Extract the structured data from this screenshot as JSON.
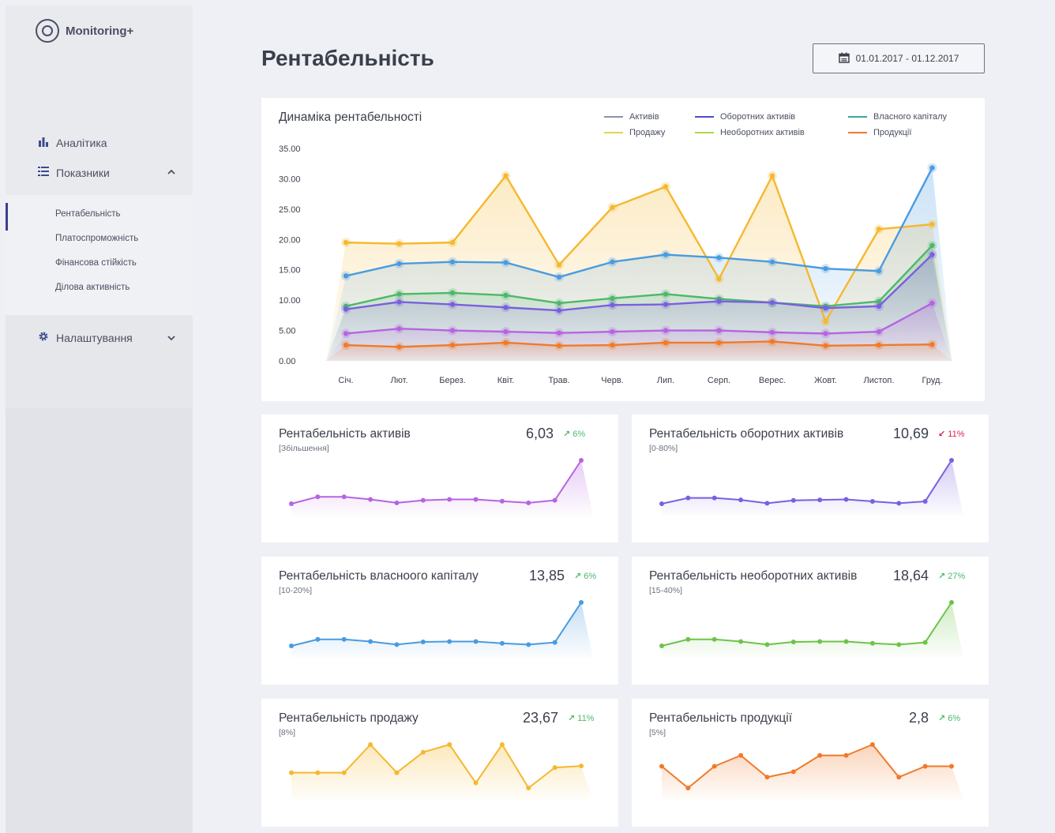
{
  "app": {
    "name": "Monitoring+"
  },
  "sidebar": {
    "nav": [
      {
        "label": "Аналітика",
        "icon": "bar-chart-icon"
      },
      {
        "label": "Показники",
        "icon": "list-icon",
        "expanded": true
      }
    ],
    "submenu": [
      "Рентабельність",
      "Платоспроможність",
      "Фінансова стійкість",
      "Ділова активність"
    ],
    "active_submenu_index": 0,
    "settings": {
      "label": "Налаштування",
      "icon": "gear-icon"
    }
  },
  "page": {
    "title": "Рентабельність",
    "date_range": "01.01.2017 - 01.12.2017"
  },
  "colors": {
    "assets": "#4a9be0",
    "current_assets": "#7a5fe0",
    "equity": "#4db86a",
    "sales": "#f5b82e",
    "noncurrent_assets": "#8dd35f",
    "products": "#f07a2a",
    "up": "#4db86a",
    "down": "#e0244a"
  },
  "chart_data": [
    {
      "type": "line",
      "title": "Динаміка рентабельності",
      "categories": [
        "Січ.",
        "Лют.",
        "Берез.",
        "Квіт.",
        "Трав.",
        "Черв.",
        "Лип.",
        "Серп.",
        "Верес.",
        "Жовт.",
        "Листоп.",
        "Груд."
      ],
      "yticks": [
        "35.00",
        "30.00",
        "25.00",
        "20.00",
        "15.00",
        "10.00",
        "5.00",
        "0.00"
      ],
      "ylim": [
        0,
        35
      ],
      "grid": false,
      "legend_position": "top-right",
      "legend": [
        "Активів",
        "Оборотних активів",
        "Власного капіталу",
        "Продажу",
        "Необоротних активів",
        "Продукції"
      ],
      "series": [
        {
          "name": "Продажу",
          "color": "#f5b82e",
          "values": [
            19.5,
            19.3,
            19.5,
            30.5,
            15.8,
            25.3,
            28.7,
            13.5,
            30.5,
            6.5,
            21.7,
            22.5
          ]
        },
        {
          "name": "Активів",
          "color": "#4a9be0",
          "values": [
            14.0,
            16.0,
            16.3,
            16.2,
            13.8,
            16.3,
            17.5,
            17.0,
            16.3,
            15.2,
            14.8,
            31.8
          ]
        },
        {
          "name": "Власного капіталу",
          "color": "#4db86a",
          "values": [
            9.0,
            11.0,
            11.2,
            10.8,
            9.5,
            10.3,
            11.0,
            10.2,
            9.6,
            9.0,
            9.8,
            19.0
          ]
        },
        {
          "name": "Оборотних активів",
          "color": "#7a5fe0",
          "values": [
            8.5,
            9.7,
            9.3,
            8.8,
            8.3,
            9.2,
            9.3,
            9.8,
            9.6,
            8.7,
            9.0,
            17.5
          ]
        },
        {
          "name": "Необоротних активів",
          "color": "#b565e0",
          "values": [
            4.5,
            5.3,
            5.0,
            4.8,
            4.6,
            4.8,
            5.0,
            5.0,
            4.7,
            4.5,
            4.8,
            9.5
          ]
        },
        {
          "name": "Продукції",
          "color": "#f07a2a",
          "values": [
            2.6,
            2.3,
            2.6,
            3.0,
            2.5,
            2.6,
            3.0,
            3.0,
            3.2,
            2.5,
            2.6,
            2.7
          ]
        }
      ]
    },
    {
      "type": "area",
      "title": "Рентабельність активів",
      "range": "[Збільшення]",
      "value": "6,03",
      "delta": "6%",
      "trend": "up",
      "color": "#b565e0",
      "values": [
        4.5,
        5.3,
        5.3,
        5.0,
        4.6,
        4.9,
        5.0,
        5.0,
        4.8,
        4.6,
        4.9,
        9.5
      ]
    },
    {
      "type": "area",
      "title": "Рентабельність оборотних активів",
      "range": "[0-80%]",
      "value": "10,69",
      "delta": "11%",
      "trend": "down",
      "color": "#7a5fe0",
      "values": [
        8.5,
        9.7,
        9.7,
        9.3,
        8.6,
        9.2,
        9.3,
        9.4,
        9.0,
        8.6,
        9.0,
        17.5
      ]
    },
    {
      "type": "area",
      "title": "Рентабельність власноого капіталу",
      "range": "[10-20%]",
      "value": "13,85",
      "delta": "6%",
      "trend": "up",
      "color": "#4a9be0",
      "values": [
        9.0,
        10.5,
        10.5,
        10.0,
        9.3,
        9.9,
        10.0,
        10.0,
        9.6,
        9.3,
        9.8,
        19.0
      ]
    },
    {
      "type": "area",
      "title": "Рентабельність необоротних активів",
      "range": "[15-40%]",
      "value": "18,64",
      "delta": "27%",
      "trend": "up",
      "color": "#6cc449",
      "values": [
        9.0,
        10.5,
        10.5,
        10.0,
        9.3,
        9.9,
        10.0,
        10.0,
        9.6,
        9.3,
        9.8,
        19.0
      ]
    },
    {
      "type": "area",
      "title": "Рентабельність продажу",
      "range": "[8%]",
      "value": "23,67",
      "delta": "11%",
      "trend": "up",
      "color": "#f5b82e",
      "values": [
        19.5,
        19.5,
        19.5,
        25.0,
        19.5,
        23.5,
        25.0,
        17.5,
        25.0,
        16.5,
        20.5,
        20.8
      ]
    },
    {
      "type": "area",
      "title": "Рентабельність продукції",
      "range": "[5%]",
      "value": "2,8",
      "delta": "6%",
      "trend": "up",
      "color": "#f07a2a",
      "values": [
        2.6,
        2.4,
        2.6,
        2.7,
        2.5,
        2.55,
        2.7,
        2.7,
        2.8,
        2.5,
        2.6,
        2.6
      ]
    }
  ]
}
